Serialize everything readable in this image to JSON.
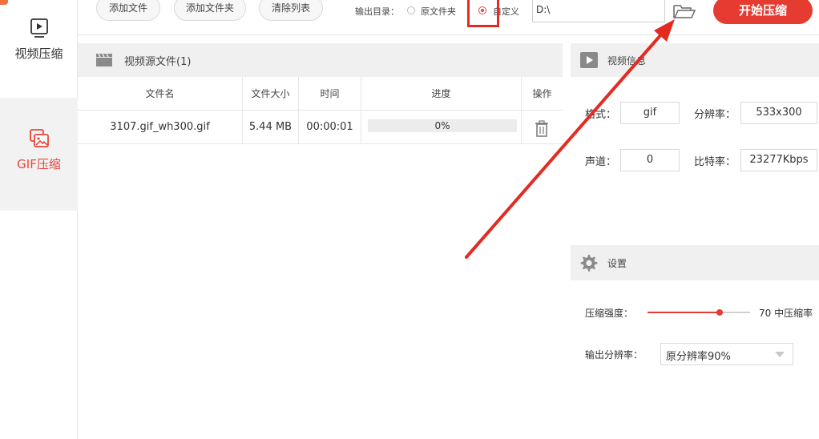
{
  "sidebar": {
    "items": [
      {
        "label": "视频压缩",
        "icon": "video-play-icon",
        "active": false
      },
      {
        "label": "GIF压缩",
        "icon": "gif-image-icon",
        "active": true
      }
    ]
  },
  "toolbar": {
    "add_file_label": "添加文件",
    "add_folder_label": "添加文件夹",
    "clear_list_label": "清除列表",
    "output_dir_label": "输出目录：",
    "option_original_label": "原文件夹",
    "option_custom_label": "自定义",
    "selected_option": "自定义",
    "output_path": "D:\\",
    "start_label": "开始压缩"
  },
  "file_panel": {
    "title": "视频源文件(1)",
    "columns": [
      "文件名",
      "文件大小",
      "时间",
      "进度",
      "操作"
    ],
    "rows": [
      {
        "name": "3107.gif_wh300.gif",
        "size": "5.44 MB",
        "time": "00:00:01",
        "progress_text": "0%",
        "progress": 0
      }
    ]
  },
  "video_info": {
    "title": "视频信息",
    "format_label": "格式：",
    "format_value": "gif",
    "resolution_label": "分辨率：",
    "resolution_value": "533x300",
    "channels_label": "声道：",
    "channels_value": "0",
    "bitrate_label": "比特率：",
    "bitrate_value": "23277Kbps"
  },
  "settings": {
    "title": "设置",
    "strength_label": "压缩强度：",
    "strength_value": 70,
    "strength_display": "70 中压缩率",
    "output_res_label": "输出分辨率：",
    "output_res_value": "原分辨率90%"
  },
  "colors": {
    "accent": "#e53b30",
    "annotation": "#e32b22",
    "panel_header": "#f0f0f0"
  }
}
